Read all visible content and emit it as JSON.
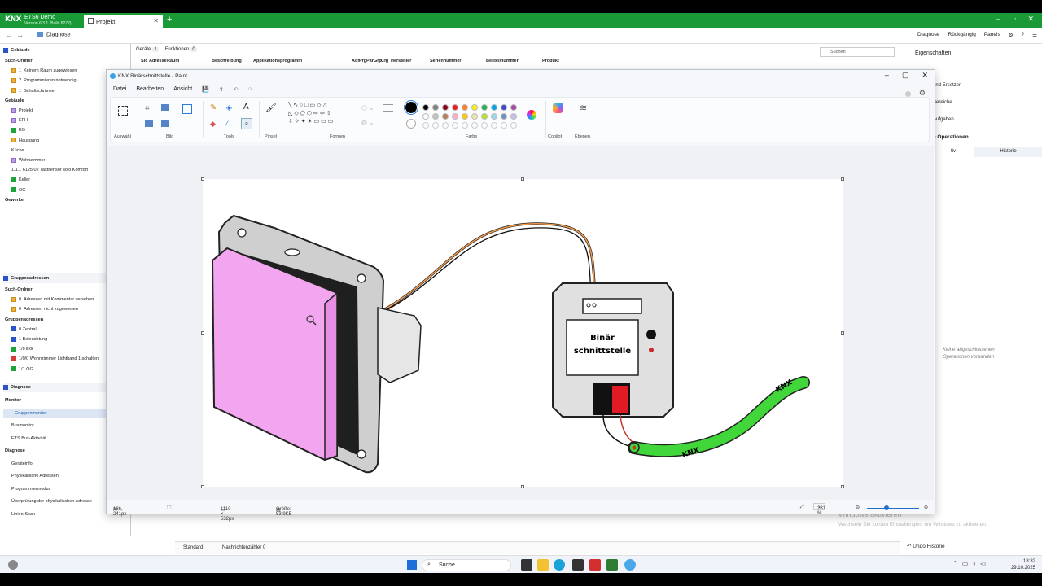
{
  "app": {
    "name": "ETS6 Demo",
    "version": "Version 6.3.1 (Build 8272)",
    "logo_text": "KNX",
    "tab": "Projekt"
  },
  "nav": {
    "crumb": "Diagnose",
    "tools": [
      "Diagnose",
      "Rückgängig",
      "Panels"
    ]
  },
  "left": {
    "top_header": "Gebäude",
    "items": [
      {
        "label": "Such-Ordner",
        "kind": "hdr"
      },
      {
        "label": "Keinem Raum zugewiesen",
        "kind": "o",
        "count": "1"
      },
      {
        "label": "Programmieren notwendig",
        "kind": "o",
        "count": "2"
      },
      {
        "label": "Schaltschränke",
        "kind": "o",
        "count": "1"
      },
      {
        "label": "Gebäude",
        "kind": "hdr"
      },
      {
        "label": "Projekt",
        "kind": "p"
      },
      {
        "label": "EFH",
        "kind": "p"
      },
      {
        "label": "EG",
        "kind": "g"
      },
      {
        "label": "Hausgang",
        "kind": "o"
      },
      {
        "label": "Küche",
        "kind": "n"
      },
      {
        "label": "Wohnzimmer",
        "kind": "p"
      },
      {
        "label": "1.1.1 6125/02 Tastsensor solo Komfort",
        "kind": "n"
      },
      {
        "label": "Keller",
        "kind": "g"
      },
      {
        "label": "OG",
        "kind": "g"
      },
      {
        "label": "Gewerke",
        "kind": "hdr"
      }
    ],
    "group_header": "Gruppenadressen",
    "group_items": [
      {
        "label": "Such-Ordner",
        "kind": "hdr"
      },
      {
        "label": "Adressen mit Kommentar versehen",
        "kind": "o",
        "count": "0"
      },
      {
        "label": "Adressen nicht zugewiesen",
        "kind": "o",
        "count": "0"
      },
      {
        "label": "Gruppenadressen",
        "kind": "hdr"
      },
      {
        "label": "0 Zentral",
        "kind": "b"
      },
      {
        "label": "1 Beleuchtung",
        "kind": "b"
      },
      {
        "label": "1/0 EG",
        "kind": "g"
      },
      {
        "label": "1/0/0 Wohnzimmer Lichtband 1 schalten",
        "kind": "r"
      },
      {
        "label": "1/1 OG",
        "kind": "g"
      }
    ],
    "diag_header": "Diagnose",
    "diag_items": [
      {
        "label": "Monitor",
        "kind": "hdr"
      },
      {
        "label": "Gruppenmonitor",
        "kind": "sel"
      },
      {
        "label": "Busmonitor",
        "kind": "n"
      },
      {
        "label": "ETS Bus-Aktivität",
        "kind": "n"
      },
      {
        "label": "Diagnose",
        "kind": "hdr"
      },
      {
        "label": "Geräteinfo",
        "kind": "n"
      },
      {
        "label": "Physikalische Adressen",
        "kind": "n"
      },
      {
        "label": "Programmiermodus",
        "kind": "n"
      },
      {
        "label": "Überprüfung der physikalischen Adresse",
        "kind": "n"
      },
      {
        "label": "Linien-Scan",
        "kind": "n"
      }
    ]
  },
  "devices": {
    "tab_devices": "Geräte",
    "tab_devices_count": "1",
    "tab_functions": "Funktionen",
    "tab_functions_count": "0",
    "search_placeholder": "Suchen",
    "columns": [
      "Sic",
      "Adresse",
      "Raum",
      "Beschreibung",
      "Applikationsprogramm",
      "Adr",
      "Prg",
      "Par",
      "Grp",
      "Cfg",
      "Hersteller",
      "Seriennummer",
      "Bestellnummer",
      "Produkt"
    ]
  },
  "right": {
    "title": "Eigenschaften",
    "items": [
      "und Ersetzen",
      "Bereiche",
      "Aufgaben",
      "e Operationen"
    ],
    "tab_left": "tiv",
    "tab_right": "Historie",
    "empty_line1": "Keine abgeschlossenen",
    "empty_line2": "Operationen vorhanden",
    "undo": "Undo Historie"
  },
  "lowstatus": {
    "standard": "Standard",
    "counter": "Nachrichtenzähler 0"
  },
  "watermark": {
    "line1": "Windows aktivieren",
    "line2": "Wechseln Sie zu den Einstellungen, um Windows zu aktivieren."
  },
  "taskbar": {
    "search": "Suche",
    "time": "18:32",
    "date": "29.10.2025"
  },
  "paint": {
    "title": "KNX Binärschnittstelle - Paint",
    "menu": [
      "Datei",
      "Bearbeiten",
      "Ansicht"
    ],
    "groups": [
      "Auswahl",
      "Bild",
      "Tools",
      "Pinsel",
      "Formen",
      "Farbe",
      "Copilot",
      "Ebenen"
    ],
    "status": {
      "cursor": "186, 241px",
      "size": "1110 × 532px",
      "filesize": "Größe: 83,9KB",
      "zoom": "281 %"
    },
    "palette_row1": [
      "#000000",
      "#7f7f7f",
      "#880015",
      "#ed1c24",
      "#ff7f27",
      "#fff200",
      "#22b14c",
      "#00a2e8",
      "#3f48cc",
      "#a349a4"
    ],
    "palette_row2": [
      "#ffffff",
      "#c3c3c3",
      "#b97a57",
      "#ffaec9",
      "#ffc90e",
      "#efe4b0",
      "#b5e61d",
      "#99d9ea",
      "#7092be",
      "#c8bfe7"
    ],
    "drawing": {
      "box_label_1": "Binär",
      "box_label_2": "schnittstelle",
      "cable_text_1": "KNX",
      "cable_text_2": "KNX"
    }
  }
}
